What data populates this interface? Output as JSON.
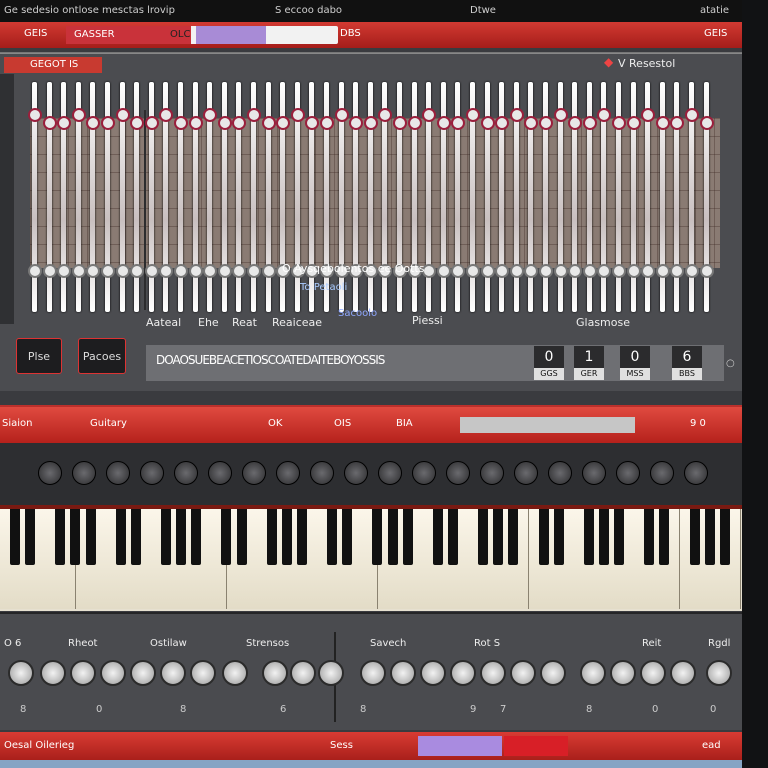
{
  "menubar": {
    "left_text": "Ge sedesio ontlose mesctas lrovip",
    "center_text": "S eccoo dabo",
    "mid_right": "Dtwe",
    "right_text": "atatie"
  },
  "toolstrip": {
    "label1": "GEIS",
    "tab_label": "GASSER",
    "tab_mid": "OLC",
    "label2": "DBS",
    "right_label": "GEIS"
  },
  "sequencer": {
    "panel_title": "GEGOT IS",
    "right_title": "V Resestol",
    "center_caption": "O Aysqebolentos  ee Ootts",
    "sub_caption": "To  Petaoli",
    "link_caption": "Sacoolo",
    "row_labels": [
      "Aateal",
      "Ehe",
      "Reat",
      "Reaiceae"
    ],
    "mid_label": "Piessi",
    "right_label": "Glasmose",
    "button_left": "Plse",
    "button_right": "Pacoes",
    "strip_text": "DOAOSUEBEACETIOSCOATEDAITEBOYOSSIS",
    "counters": [
      {
        "value": "0",
        "sub": "GGS"
      },
      {
        "value": "1",
        "sub": "GER"
      },
      {
        "value": "0",
        "sub": "MSS"
      },
      {
        "value": "6",
        "sub": "BBS"
      }
    ]
  },
  "synth": {
    "label1": "Siaion",
    "label2": "Guitary",
    "label3": "OK",
    "label4": "OIS",
    "label5": "BIA",
    "right_value": "9 0"
  },
  "bottom": {
    "group_labels": [
      "O 6",
      "Rheot",
      "Ostilaw",
      "Strensos",
      "Savech",
      "Rot S",
      "Reit",
      "Rgdl"
    ],
    "dial_values": [
      "8",
      "0",
      "8",
      "6",
      "8",
      "9",
      "7",
      "8",
      "0",
      "0"
    ]
  },
  "footer": {
    "left_text": "Oesal  Oilerieg",
    "center_text": "Sess",
    "right_text": "ead"
  },
  "colors": {
    "accent_red": "#c62a25",
    "lavender": "#a98be0",
    "panel": "#4b4c50"
  }
}
